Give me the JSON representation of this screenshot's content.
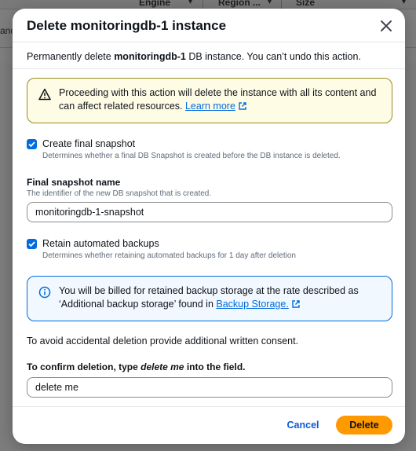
{
  "background": {
    "columns": [
      "Engine",
      "Region ...",
      "Size"
    ],
    "left_cell": "ance"
  },
  "modal": {
    "title": "Delete monitoringdb-1 instance",
    "intro_prefix": "Permanently delete ",
    "intro_instance": "monitoringdb-1",
    "intro_suffix": " DB instance. You can’t undo this action.",
    "warning": {
      "text": "Proceeding with this action will delete the instance with all its content and can affect related resources. ",
      "link": "Learn more"
    },
    "final_snapshot": {
      "label": "Create final snapshot",
      "description": "Determines whether a final DB Snapshot is created before the DB instance is deleted.",
      "checked": true
    },
    "snapshot_name": {
      "label": "Final snapshot name",
      "description": "The identifier of the new DB snapshot that is created.",
      "value": "monitoringdb-1-snapshot"
    },
    "retain_backups": {
      "label": "Retain automated backups",
      "description": "Determines whether retaining automated backups for 1 day after deletion",
      "checked": true
    },
    "info": {
      "text": "You will be billed for retained backup storage at the rate described as ‘Additional backup storage’ found in ",
      "link": "Backup Storage."
    },
    "consent_text": "To avoid accidental deletion provide additional written consent.",
    "confirm": {
      "label_prefix": "To confirm deletion, type ",
      "label_phrase": "delete me",
      "label_suffix": " into the field.",
      "value": "delete me"
    },
    "cancel_label": "Cancel",
    "delete_label": "Delete"
  },
  "colors": {
    "primary_button": "#ff9900",
    "link": "#006ce0",
    "warning_border": "#9a8a1d",
    "info_border": "#006ce0"
  }
}
